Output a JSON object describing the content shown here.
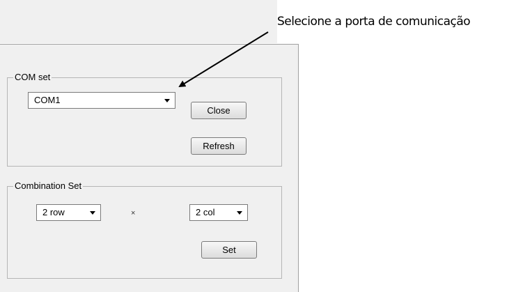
{
  "annotation": {
    "text": "Selecione a porta de comunicação"
  },
  "com_set": {
    "title": "COM set",
    "port_selected": "COM1",
    "close_label": "Close",
    "refresh_label": "Refresh"
  },
  "combination_set": {
    "title": "Combination Set",
    "rows_selected": "2 row",
    "times": "×",
    "cols_selected": "2 col",
    "set_label": "Set"
  }
}
